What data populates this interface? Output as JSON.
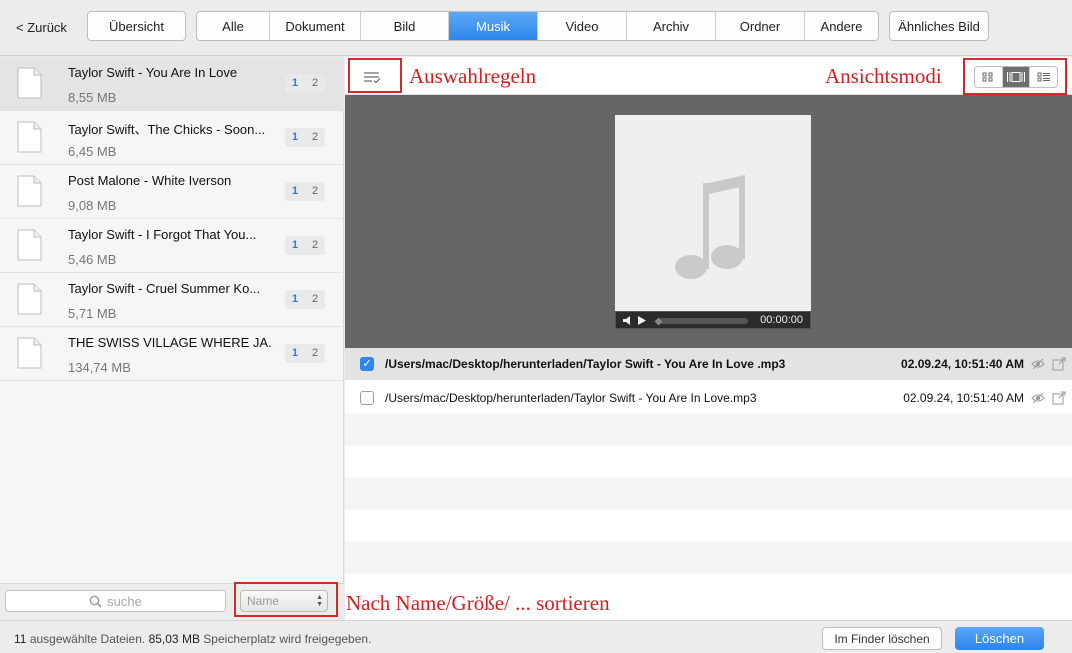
{
  "toolbar": {
    "back_label": "< Zurück",
    "overview_label": "Übersicht",
    "similar_label": "Ähnliches Bild",
    "tabs": [
      {
        "label": "Alle"
      },
      {
        "label": "Dokument"
      },
      {
        "label": "Bild"
      },
      {
        "label": "Musik",
        "active": true
      },
      {
        "label": "Video"
      },
      {
        "label": "Archiv"
      },
      {
        "label": "Ordner"
      },
      {
        "label": "Andere"
      }
    ]
  },
  "files": [
    {
      "name": "Taylor Swift - You Are In Love",
      "size": "8,55 MB",
      "badge1": "1",
      "badge2": "2",
      "selected": true
    },
    {
      "name": "Taylor Swift、The Chicks - Soon...",
      "size": "6,45 MB",
      "badge1": "1",
      "badge2": "2"
    },
    {
      "name": "Post Malone - White Iverson",
      "size": "9,08 MB",
      "badge1": "1",
      "badge2": "2"
    },
    {
      "name": "Taylor Swift - I Forgot That You...",
      "size": "5,46 MB",
      "badge1": "1",
      "badge2": "2"
    },
    {
      "name": "Taylor Swift - Cruel Summer Ko...",
      "size": "5,71 MB",
      "badge1": "1",
      "badge2": "2"
    },
    {
      "name": "THE SWISS VILLAGE WHERE JA...",
      "size": "134,74 MB",
      "badge1": "1",
      "badge2": "2"
    }
  ],
  "search": {
    "placeholder": "suche"
  },
  "sort": {
    "value": "Name"
  },
  "player": {
    "time": "00:00:00"
  },
  "duplicates": [
    {
      "path": "/Users/mac/Desktop/herunterladen/Taylor Swift - You Are In Love .mp3",
      "date": "02.09.24, 10:51:40 AM",
      "checked": true
    },
    {
      "path": "/Users/mac/Desktop/herunterladen/Taylor Swift - You Are In Love.mp3",
      "date": "02.09.24, 10:51:40 AM",
      "checked": false
    }
  ],
  "status": {
    "count": "11",
    "text1": "ausgewählte Dateien.",
    "size": "85,03 MB",
    "text2": "Speicherplatz wird freigegeben.",
    "finder_label": "Im Finder löschen",
    "delete_label": "Löschen"
  },
  "annotations": {
    "rules": "Auswahlregeln",
    "viewmodes": "Ansichtsmodi",
    "sort": "Nach Name/Größe/ ... sortieren"
  },
  "colors": {
    "accent": "#2f86ec",
    "annotation": "#d32b2b"
  }
}
